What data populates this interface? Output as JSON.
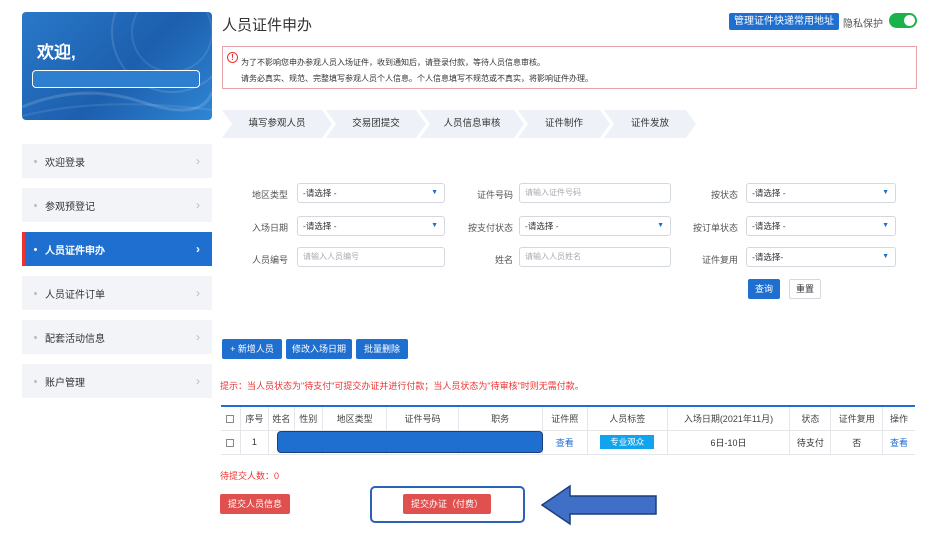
{
  "sidebar": {
    "welcome": "欢迎,",
    "items": [
      {
        "label": "欢迎登录",
        "active": false
      },
      {
        "label": "参观预登记",
        "active": false
      },
      {
        "label": "人员证件申办",
        "active": true
      },
      {
        "label": "人员证件订单",
        "active": false
      },
      {
        "label": "配套活动信息",
        "active": false
      },
      {
        "label": "账户管理",
        "active": false
      }
    ]
  },
  "header": {
    "title": "人员证件申办",
    "address_button": "管理证件快递常用地址",
    "privacy_label": "隐私保护",
    "privacy_on": true
  },
  "notice": {
    "line1": "为了不影响您申办参观人员入场证件，收到通知后，请登录付款，等待人员信息审核。",
    "line2": "请务必真实、规范、完整填写参观人员个人信息。个人信息填写不规范或不真实，将影响证件办理。"
  },
  "steps": [
    "填写参观人员",
    "交易团提交",
    "人员信息审核",
    "证件制作",
    "证件发放"
  ],
  "filters": {
    "region_label": "地区类型",
    "region_value": "-请选择 -",
    "idno_label": "证件号码",
    "idno_placeholder": "请输入证件号码",
    "status_label": "按状态",
    "status_value": "-请选择 -",
    "entry_label": "入场日期",
    "entry_value": "-请选择 -",
    "pay_label": "按支付状态",
    "pay_value": "-请选择 -",
    "order_label": "按订单状态",
    "order_value": "-请选择 -",
    "person_label": "人员编号",
    "person_placeholder": "请输入人员编号",
    "name_label": "姓名",
    "name_placeholder": "请输入人员姓名",
    "reuse_label": "证件复用",
    "reuse_value": "-请选择-",
    "query": "查询",
    "reset": "重置"
  },
  "actions": {
    "add": "+ 新增人员",
    "modify_date": "修改入场日期",
    "batch_delete": "批量删除"
  },
  "tip": "提示：当人员状态为\"待支付\"可提交办证并进行付款；当人员状态为\"待审核\"时则无需付款。",
  "table": {
    "headers": [
      "序号",
      "姓名",
      "性别",
      "地区类型",
      "证件号码",
      "职务",
      "证件照",
      "人员标签",
      "入场日期(2021年11月)",
      "状态",
      "证件复用",
      "操作"
    ],
    "rows": [
      {
        "index": "1",
        "photo": "查看",
        "tag": "专业观众",
        "date": "6日-10日",
        "status": "待支付",
        "reuse": "否",
        "op": "查看"
      }
    ]
  },
  "pending": "待提交人数：",
  "pending_count": "0",
  "submit_info": "提交人员信息",
  "submit_pay": "提交办证（付费）",
  "colors": {
    "primary": "#1e6fcf",
    "danger": "#e0504f",
    "toggle": "#1ab34a",
    "tag": "#11a4ee"
  }
}
